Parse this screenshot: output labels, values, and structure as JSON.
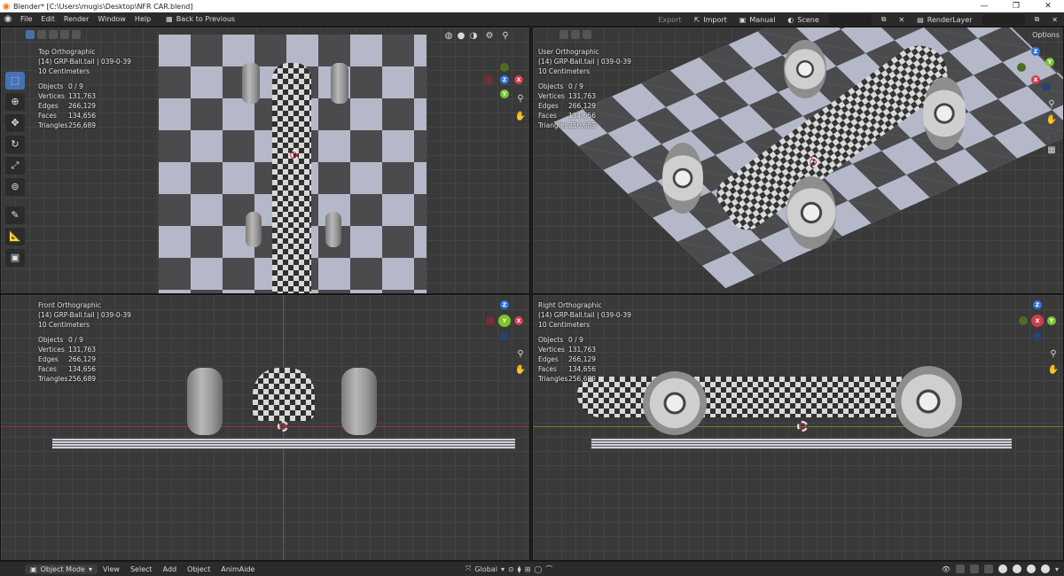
{
  "window": {
    "title": "Blender* [C:\\Users\\mugis\\Desktop\\NFR CAR.blend]",
    "minimize": "—",
    "maximize": "❐",
    "close": "✕"
  },
  "menubar": {
    "items": [
      "File",
      "Edit",
      "Render",
      "Window",
      "Help"
    ],
    "back_label": "Back to Previous",
    "export_label": "Export",
    "import_label": "Import",
    "manual_label": "Manual",
    "scene_label": "Scene",
    "renderlayer_label": "RenderLayer"
  },
  "viewports": {
    "top": {
      "name": "Top Orthographic",
      "collection": "(14) GRP-Ball.tail | 039-0-39",
      "scale": "10 Centimeters"
    },
    "user": {
      "name": "User Orthographic",
      "collection": "(14) GRP-Ball.tail | 039-0-39",
      "scale": "10 Centimeters",
      "options": "Options"
    },
    "front": {
      "name": "Front Orthographic",
      "collection": "(14) GRP-Ball.tail | 039-0-39",
      "scale": "10 Centimeters"
    },
    "right": {
      "name": "Right Orthographic",
      "collection": "(14) GRP-Ball.tail | 039-0-39",
      "scale": "10 Centimeters"
    }
  },
  "stats": {
    "objects_label": "Objects",
    "objects": "0 / 9",
    "vertices_label": "Vertices",
    "vertices": "131,763",
    "edges_label": "Edges",
    "edges": "266,129",
    "faces_label": "Faces",
    "faces": "134,656",
    "triangles_label": "Triangles",
    "triangles": "256,689"
  },
  "gizmo": {
    "x": "X",
    "y": "Y",
    "z": "Z"
  },
  "statusbar": {
    "mode": "Object Mode",
    "items": [
      "View",
      "Select",
      "Add",
      "Object",
      "AnimAide"
    ],
    "orientation": "Global"
  },
  "colors": {
    "accent": "#4772b3",
    "x_axis": "#d33b4d",
    "y_axis": "#7ac62b",
    "z_axis": "#2e76d9"
  }
}
